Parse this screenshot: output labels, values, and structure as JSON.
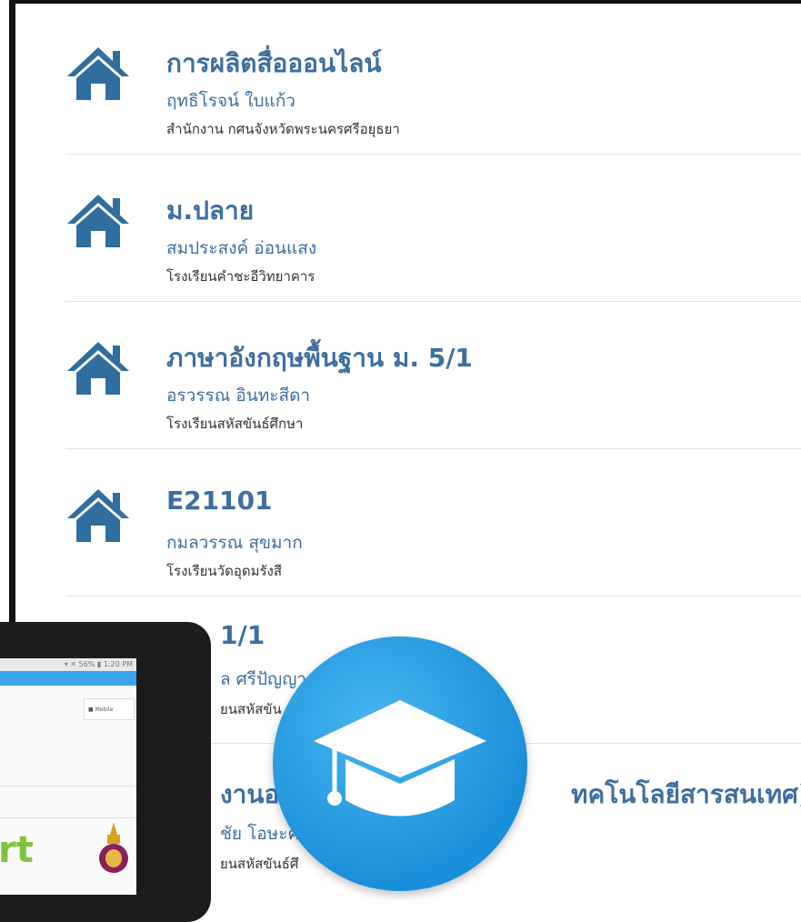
{
  "courses": [
    {
      "title": "การผลิตสื่อออนไลน์",
      "teacher": "ฤทธิโรจน์ ใบแก้ว",
      "school": "สำนักงาน กศนจังหวัดพระนครศรีอยุธยา"
    },
    {
      "title": "ม.ปลาย",
      "teacher": "สมประสงค์ อ่อนแสง",
      "school": "โรงเรียนคำชะอีวิทยาคาร"
    },
    {
      "title": "ภาษาอังกฤษพื้นฐาน ม. 5/1",
      "teacher": "อรวรรณ อินทะสีดา",
      "school": "โรงเรียนสหัสขันธ์ศึกษา"
    },
    {
      "title": "E21101",
      "teacher": "กมลวรรณ สุขมาก",
      "school": "โรงเรียนวัดอุดมรังสี"
    },
    {
      "title": "1/1",
      "teacher": "ล ศรีปัญญา",
      "school": "ยนสหัสขัน"
    },
    {
      "title": "งานอา",
      "title_tail": "ทคโนโลยีสารสนเทศ)",
      "teacher": "ชัย โอษะค",
      "school": "ยนสหัสขันธ์ศึ"
    }
  ],
  "tablet": {
    "status_text": "▾ ✕ 56% ▮ 1:20 PM",
    "chip_label": "■ Mobile",
    "wordmark": "rt"
  },
  "icons": {
    "course_icon": "home-icon",
    "badge_icon": "graduation-cap-icon",
    "tablet_emblem": "crest-emblem-icon"
  },
  "colors": {
    "title": "#3d6fa0",
    "icon": "#2f6e9e",
    "badge": "#2c9fe6",
    "wordmark": "#7cc43e"
  }
}
